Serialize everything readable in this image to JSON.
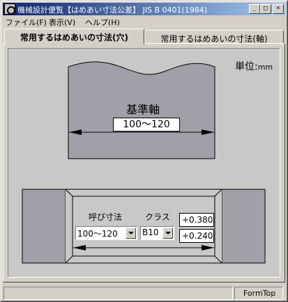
{
  "window": {
    "title": "機械設計便覧【はめあい寸法公差】 JIS B 0401(1984)",
    "min_glyph": "_",
    "max_glyph": "□",
    "close_glyph": "×"
  },
  "menu": {
    "file": "ファイル(F)",
    "view": "表示(V)",
    "help": "ヘルプ(H)"
  },
  "tabs": {
    "active": "常用するはめあいの寸法(穴)",
    "inactive": "常用するはめあいの寸法(軸)"
  },
  "unit": {
    "label": "単位:",
    "value": "mm"
  },
  "shaft": {
    "title": "基準軸",
    "size": "100〜120"
  },
  "hole": {
    "size_label": "呼び寸法",
    "class_label": "クラス",
    "size_value": "100〜120",
    "class_value": "B10",
    "upper_tol": "+0.380",
    "lower_tol": "+0.240"
  },
  "status": {
    "pane1": "",
    "pane2": "FormTop"
  },
  "colors": {
    "shaft_fill": "#a0a0a8",
    "hole_fill": "#a0a0a8",
    "title_bar_start": "#0a246a",
    "title_bar_end": "#a6caf0"
  }
}
